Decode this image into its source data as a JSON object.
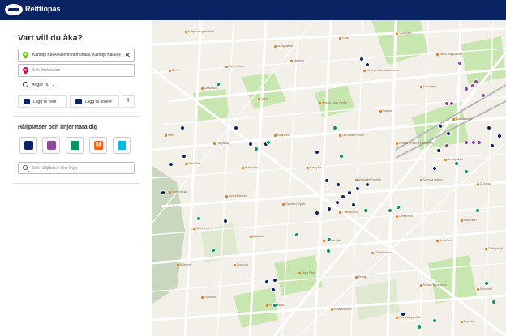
{
  "app": {
    "brand": "Reittiopas"
  },
  "panel": {
    "title": "Vart vill du åka?",
    "origin_value": "Kamppi Kaukoliikenneterminaali, Kamppi Kaukoli",
    "destination_placeholder": "Sök destination",
    "depart_label": "Avgår nu",
    "add_home_label": "Lägg till hem",
    "add_work_label": "Lägg till arbete",
    "plus_label": "+",
    "nearby_title": "Hållplatser och linjer nära dig",
    "metro_letter": "M",
    "stop_search_placeholder": "Sök hållplatser eller linjer"
  },
  "colors": {
    "header_bg": "#0a2463",
    "bus": "#0a2463",
    "tram": "#00985f",
    "train": "#8c4799",
    "metro": "#ff6319",
    "ferry": "#00b9e4"
  },
  "map": {
    "pois": [
      "Kampin kauppakeskus",
      "Glasspalatset",
      "Forum",
      "Stockmann",
      "Vanha ylioppilastalo",
      "Bio Rex",
      "Kamppi Kapel",
      "Ateneum",
      "Helsingin Päärautatieasema",
      "Kaisaniemi",
      "Citykäytävä",
      "Sokos",
      "Helsinki Music Centre",
      "Kiasma",
      "Eduskuntatalo",
      "Oodi",
      "Lasipalatsi",
      "Kampintori",
      "Old Student House",
      "Helsinki School of Economics",
      "Tennispalatsi",
      "Hotel Torni",
      "Ruttopuisto",
      "Kaivopiha",
      "Aleksanterin teatteri",
      "Svenska Teatern",
      "Esplanadi",
      "Vanha kirkko",
      "Kansallisteatteri",
      "Yliopiston kirjasto",
      "Tuomiokirkko",
      "Senaatintori",
      "Kauppatori",
      "Ritarihuone",
      "Säätytalo",
      "Kruununhaka",
      "Ylioppilasaukio",
      "Amos Rex",
      "Sinebrychoff",
      "Bulevardi",
      "Punavuori",
      "Diana Park",
      "Erottaja",
      "Kolmen sepän aukio",
      "Mikonkatu",
      "Yrjönkatu",
      "Fredrikinkatu",
      "Hietalahdentori",
      "Vanha Kauppahalli",
      "Uspenski"
    ]
  }
}
